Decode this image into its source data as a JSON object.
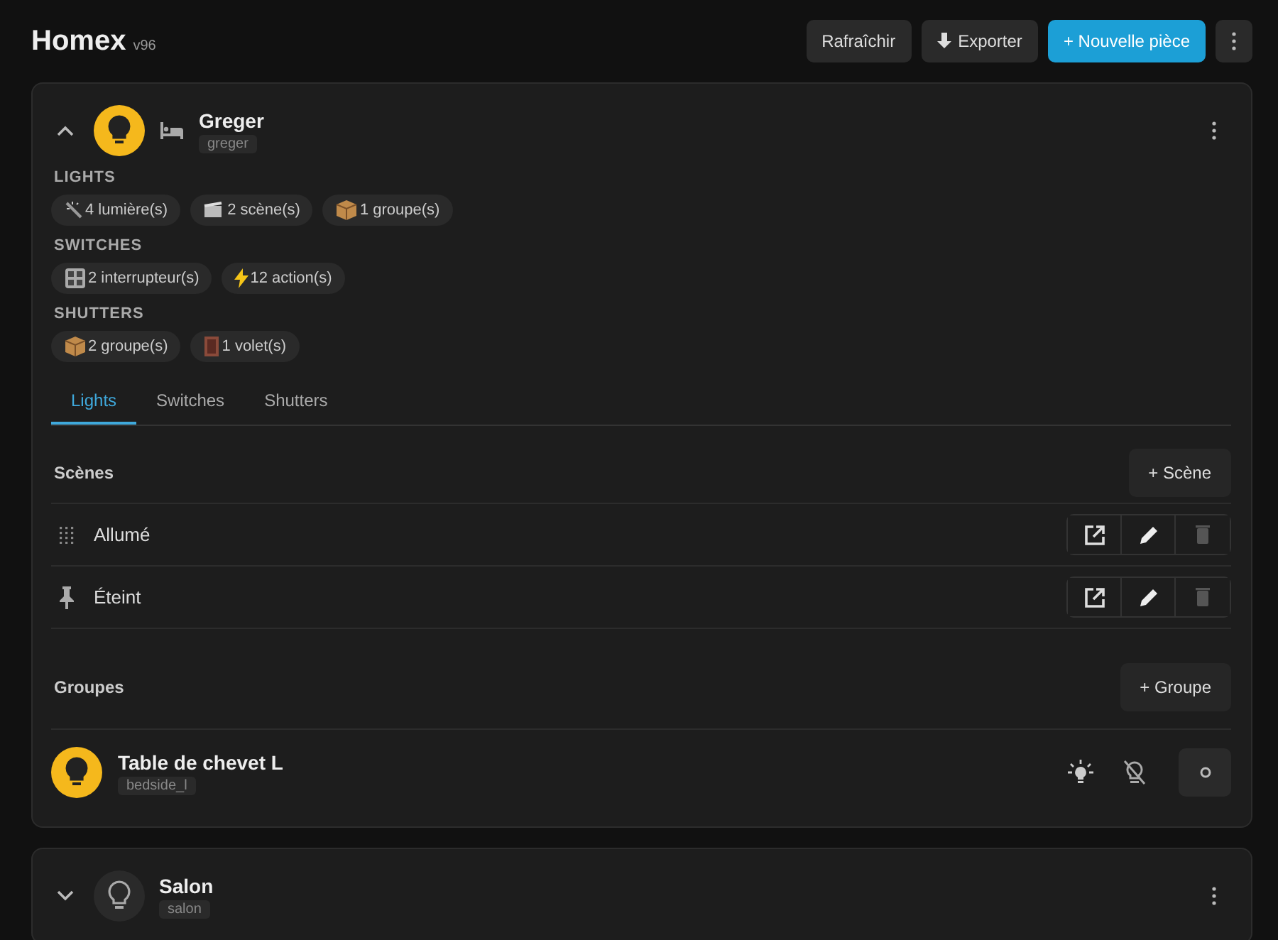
{
  "app": {
    "title": "Homex",
    "version": "v96"
  },
  "toolbar": [
    {
      "kind": "plain",
      "label": "Rafraîchir"
    },
    {
      "kind": "export",
      "label": "Exporter"
    },
    {
      "kind": "primary",
      "label": "+ Nouvelle pièce"
    },
    {
      "kind": "more"
    }
  ],
  "rooms": [
    {
      "name": "Greger",
      "slug": "greger",
      "expanded": true,
      "lit": true,
      "kind": "bedroom",
      "categories": [
        {
          "title": "LIGHTS",
          "chips": [
            {
              "kind": "wand",
              "label": "4 lumière(s)"
            },
            {
              "kind": "scene",
              "label": "2 scène(s)"
            },
            {
              "kind": "box",
              "label": "1 groupe(s)"
            }
          ]
        },
        {
          "title": "SWITCHES",
          "chips": [
            {
              "kind": "grid",
              "label": "2 interrupteur(s)"
            },
            {
              "kind": "bolt",
              "label": "12 action(s)"
            }
          ]
        },
        {
          "title": "SHUTTERS",
          "chips": [
            {
              "kind": "box",
              "label": "2 groupe(s)"
            },
            {
              "kind": "door",
              "label": "1 volet(s)"
            }
          ]
        }
      ],
      "tabs": [
        {
          "label": "Lights",
          "selected": true
        },
        {
          "label": "Switches",
          "selected": false
        },
        {
          "label": "Shutters",
          "selected": false
        }
      ],
      "scenes": {
        "title": "Scènes",
        "add": "+ Scène",
        "items": [
          {
            "name": "Allumé",
            "pinned": false
          },
          {
            "name": "Éteint",
            "pinned": true
          }
        ]
      },
      "groups": {
        "title": "Groupes",
        "add": "+ Groupe",
        "items": [
          {
            "name": "Table de chevet L",
            "slug": "bedside_l",
            "on": true
          }
        ]
      }
    },
    {
      "name": "Salon",
      "slug": "salon",
      "expanded": false,
      "lit": false,
      "kind": "other"
    }
  ]
}
